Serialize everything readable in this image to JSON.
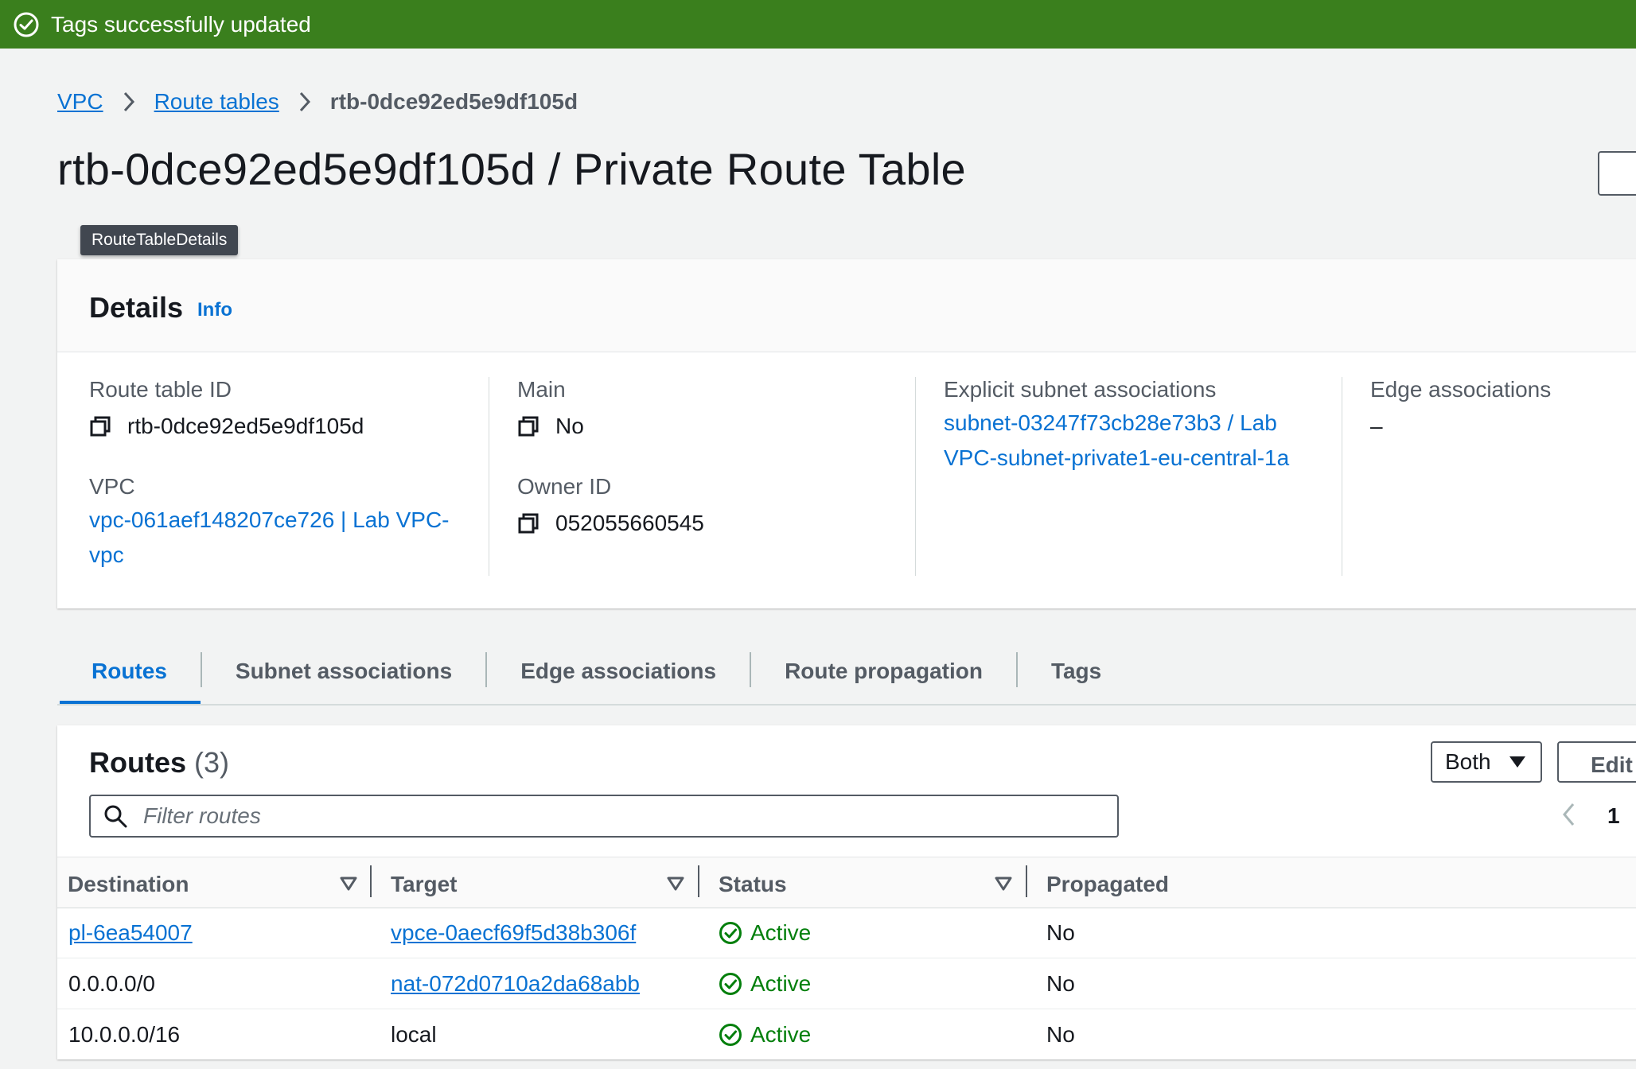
{
  "flash": {
    "message": "Tags successfully updated",
    "color": "#3a7f1d"
  },
  "breadcrumb": {
    "items": [
      "VPC",
      "Route tables"
    ],
    "current": "rtb-0dce92ed5e9df105d"
  },
  "page": {
    "title": "rtb-0dce92ed5e9df105d / Private Route Table",
    "tooltip": "RouteTableDetails"
  },
  "details": {
    "title": "Details",
    "info": "Info",
    "route_table_id": {
      "label": "Route table ID",
      "value": "rtb-0dce92ed5e9df105d"
    },
    "vpc": {
      "label": "VPC",
      "value_line1": "vpc-061aef148207ce726 | Lab VPC-",
      "value_line2": "vpc"
    },
    "main": {
      "label": "Main",
      "value": "No"
    },
    "owner_id": {
      "label": "Owner ID",
      "value": "052055660545"
    },
    "explicit_subnet": {
      "label": "Explicit subnet associations",
      "value_line1": "subnet-03247f73cb28e73b3 / Lab",
      "value_line2": "VPC-subnet-private1-eu-central-1a"
    },
    "edge": {
      "label": "Edge associations",
      "value": "–"
    }
  },
  "tabs": [
    "Routes",
    "Subnet associations",
    "Edge associations",
    "Route propagation",
    "Tags"
  ],
  "routes": {
    "title": "Routes",
    "count": "(3)",
    "filter_select": "Both",
    "edit_label": "Edit",
    "search_placeholder": "Filter routes",
    "page_number": "1",
    "columns": [
      "Destination",
      "Target",
      "Status",
      "Propagated"
    ],
    "rows": [
      {
        "destination": "pl-6ea54007",
        "target": "vpce-0aecf69f5d38b306f",
        "status": "Active",
        "propagated": "No"
      },
      {
        "destination": "0.0.0.0/0",
        "target": "nat-072d0710a2da68abb",
        "status": "Active",
        "propagated": "No"
      },
      {
        "destination": "10.0.0.0/16",
        "target": "local",
        "status": "Active",
        "propagated": "No"
      }
    ]
  },
  "colors": {
    "link": "#0972d3",
    "success": "#037f0c",
    "text": "#16191f",
    "muted": "#545b64"
  }
}
